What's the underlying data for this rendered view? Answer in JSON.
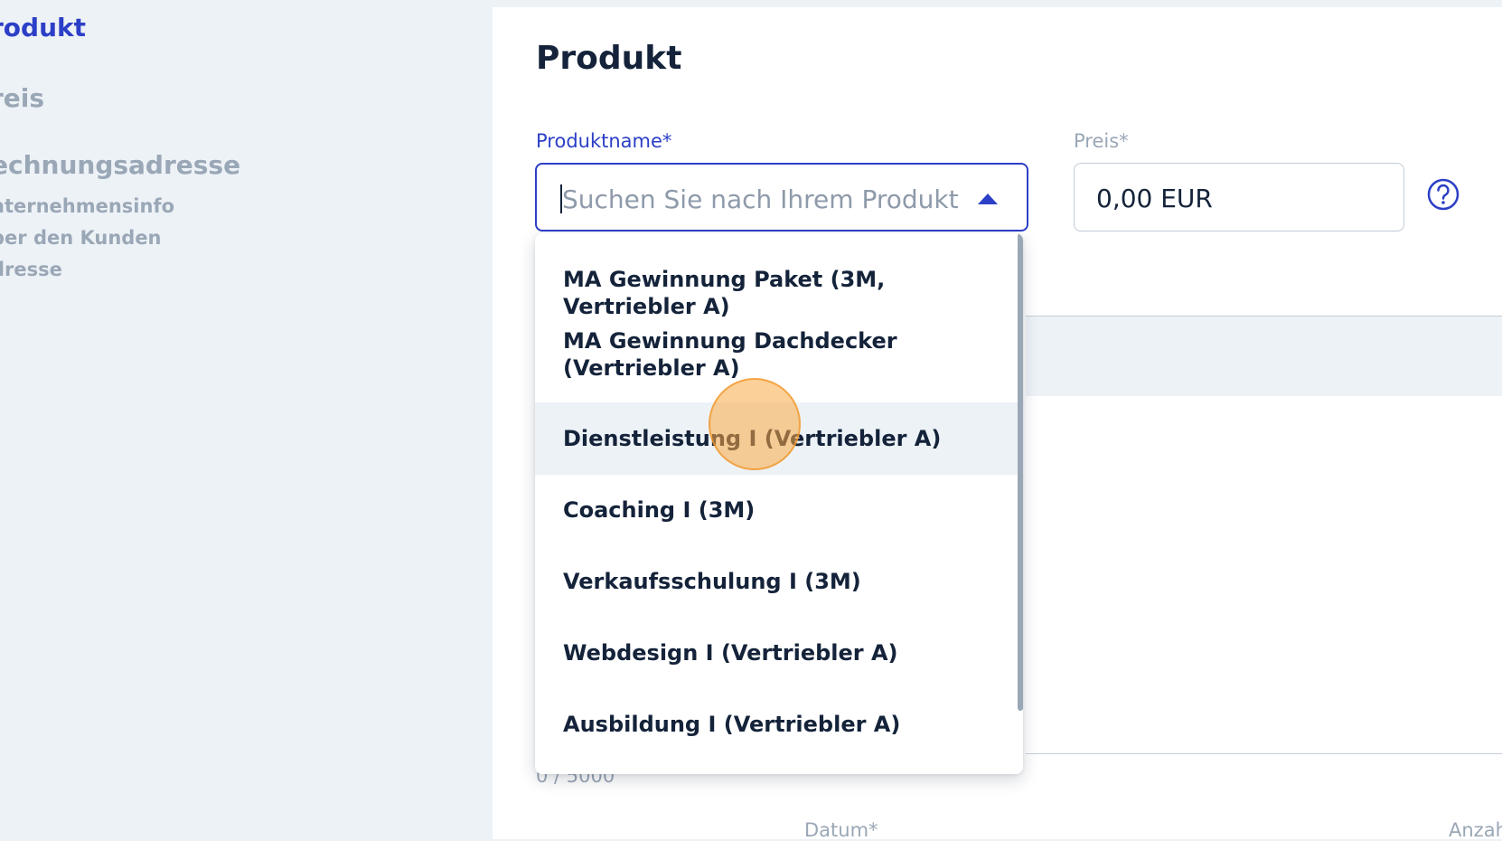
{
  "sidebar": {
    "items": [
      {
        "label": "rodukt"
      },
      {
        "label": "reis"
      },
      {
        "label": "echnungsadresse"
      },
      {
        "label": "nternehmensinfo"
      },
      {
        "label": "ber den Kunden"
      },
      {
        "label": "dresse"
      }
    ]
  },
  "main": {
    "title": "Produkt",
    "product_name": {
      "label": "Produktname*",
      "placeholder": "Suchen Sie nach Ihrem Produkt",
      "value": ""
    },
    "price": {
      "label": "Preis*",
      "value": "0,00 EUR"
    },
    "description_counter": "0 / 5000",
    "date_label": "Datum*",
    "quantity_label": "Anzahl"
  },
  "dropdown": {
    "options": [
      {
        "label": "MA Gewinnung Paket (3M, Vertriebler A)"
      },
      {
        "label": "MA Gewinnung Dachdecker (Vertriebler A)"
      },
      {
        "label": "Dienstleistung I (Vertriebler A)"
      },
      {
        "label": "Coaching I (3M)"
      },
      {
        "label": "Verkaufsschulung I (3M)"
      },
      {
        "label": "Webdesign I (Vertriebler A)"
      },
      {
        "label": "Ausbildung I (Vertriebler A)"
      }
    ],
    "highlighted_index": 2
  },
  "colors": {
    "accent": "#2c3fc7",
    "text": "#14233a",
    "muted": "#9aa7b6",
    "background": "#edf2f7"
  },
  "icons": {
    "help": "question-circle-icon",
    "toggle": "arrow-up-icon"
  }
}
